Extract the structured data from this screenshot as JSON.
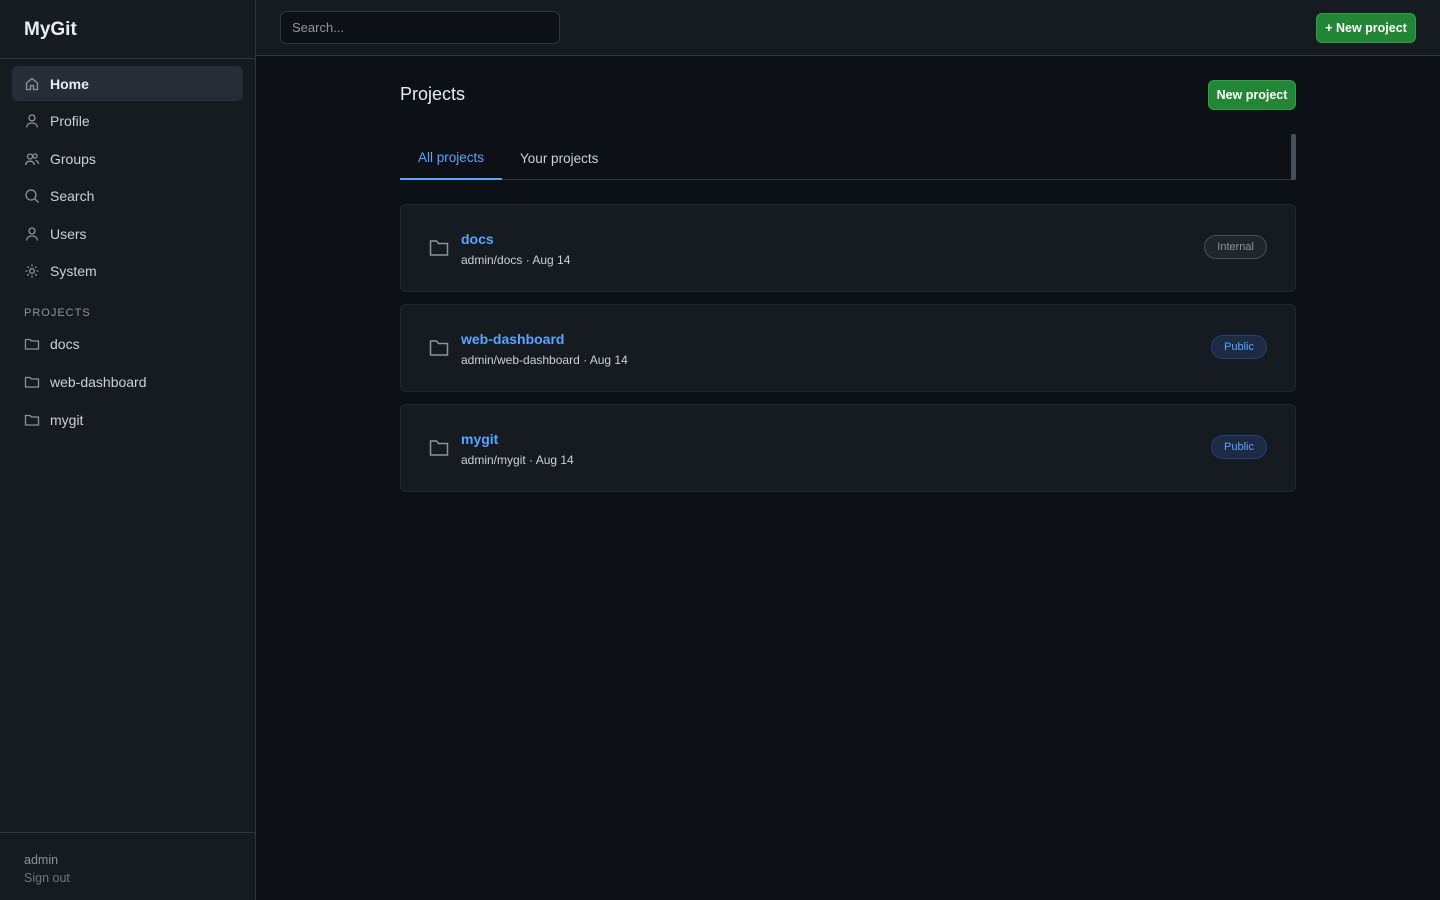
{
  "app": {
    "title": "MyGit"
  },
  "sidebar": {
    "nav": [
      {
        "label": "Home",
        "icon": "home-icon",
        "active": true
      },
      {
        "label": "Profile",
        "icon": "user-icon"
      },
      {
        "label": "Groups",
        "icon": "users-icon"
      },
      {
        "label": "Search",
        "icon": "search-icon"
      },
      {
        "label": "Users",
        "icon": "user-icon"
      },
      {
        "label": "System",
        "icon": "gear-icon"
      }
    ],
    "projects_heading": "PROJECTS",
    "projects": [
      {
        "label": "docs",
        "icon": "folder-icon"
      },
      {
        "label": "web-dashboard",
        "icon": "folder-icon"
      },
      {
        "label": "mygit",
        "icon": "folder-icon"
      }
    ],
    "footer": {
      "user": "admin",
      "signout": "Sign out"
    }
  },
  "topbar": {
    "search_placeholder": "Search...",
    "new_project_label": "+ New project"
  },
  "main": {
    "title": "Projects",
    "new_project_label": "New project",
    "tabs": [
      {
        "label": "All projects",
        "active": true
      },
      {
        "label": "Your projects",
        "active": false
      }
    ],
    "projects": [
      {
        "name": "docs",
        "meta": "admin/docs · Aug 14",
        "visibility": "Internal"
      },
      {
        "name": "web-dashboard",
        "meta": "admin/web-dashboard · Aug 14",
        "visibility": "Public"
      },
      {
        "name": "mygit",
        "meta": "admin/mygit · Aug 14",
        "visibility": "Public"
      }
    ]
  },
  "colors": {
    "background": "#0d1117",
    "sidebar": "#161b22",
    "accent": "#58a6ff",
    "button": "#238636"
  }
}
